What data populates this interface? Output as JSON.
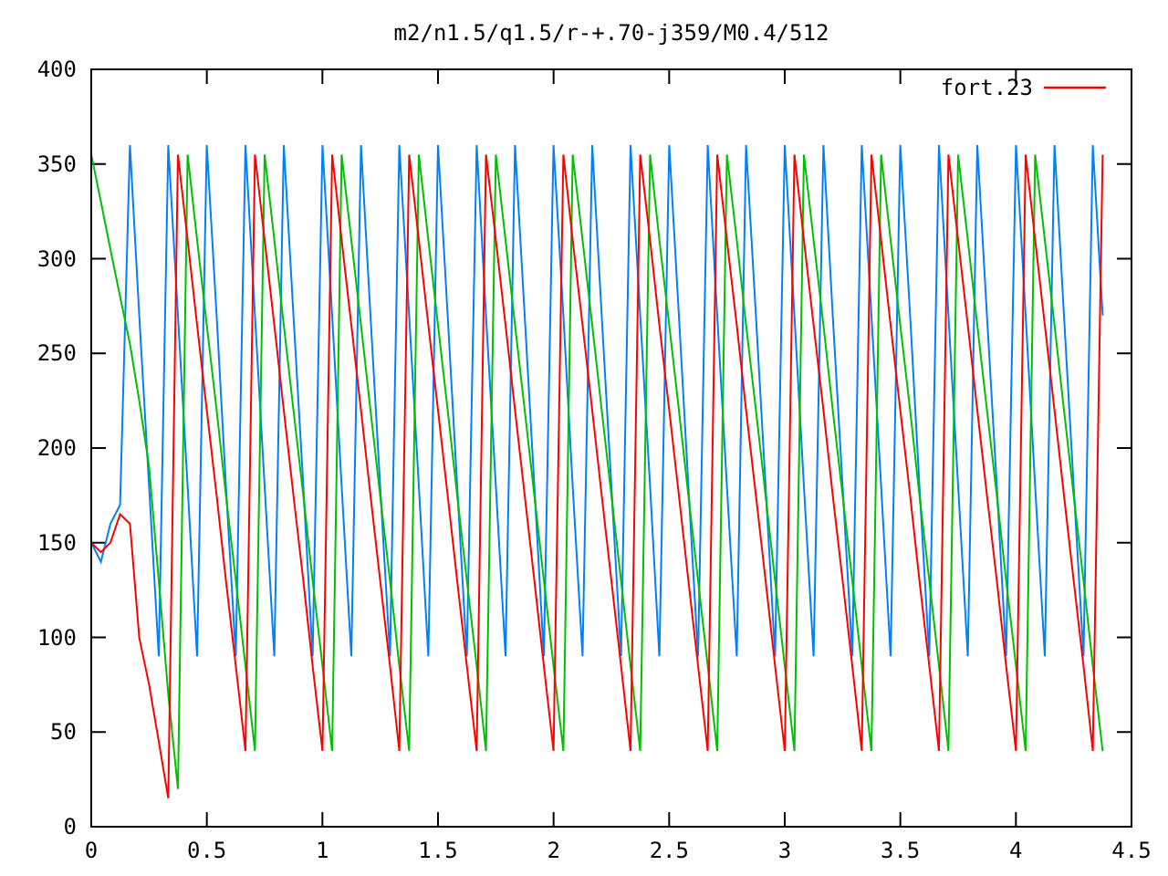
{
  "chart": {
    "chart_data": {
      "type": "line",
      "title": "m2/n1.5/q1.5/r-+.70-j359/M0.4/512",
      "xlim": [
        0,
        4.5
      ],
      "ylim": [
        0,
        400
      ],
      "xticks": [
        0,
        0.5,
        1,
        1.5,
        2,
        2.5,
        3,
        3.5,
        4,
        4.5
      ],
      "yticks": [
        0,
        50,
        100,
        150,
        200,
        250,
        300,
        350,
        400
      ],
      "x": [
        0,
        0.042,
        0.083,
        0.125,
        0.167,
        0.208,
        0.25,
        0.292,
        0.333,
        0.375,
        0.417,
        0.458,
        0.5,
        0.542,
        0.583,
        0.625,
        0.667,
        0.708,
        0.75,
        0.792,
        0.833,
        0.875,
        0.917,
        0.958,
        1,
        1.042,
        1.083,
        1.125,
        1.167,
        1.208,
        1.25,
        1.292,
        1.333,
        1.375,
        1.417,
        1.458,
        1.5,
        1.542,
        1.583,
        1.625,
        1.667,
        1.708,
        1.75,
        1.792,
        1.833,
        1.875,
        1.917,
        1.958,
        2,
        2.042,
        2.083,
        2.125,
        2.167,
        2.208,
        2.25,
        2.292,
        2.333,
        2.375,
        2.417,
        2.458,
        2.5,
        2.542,
        2.583,
        2.625,
        2.667,
        2.708,
        2.75,
        2.792,
        2.833,
        2.875,
        2.917,
        2.958,
        3,
        3.042,
        3.083,
        3.125,
        3.167,
        3.208,
        3.25,
        3.292,
        3.333,
        3.375,
        3.417,
        3.458,
        3.5,
        3.542,
        3.583,
        3.625,
        3.667,
        3.708,
        3.75,
        3.792,
        3.833,
        3.875,
        3.917,
        3.958,
        4,
        4.042,
        4.083,
        4.125,
        4.167,
        4.208,
        4.25,
        4.292,
        4.333,
        4.375
      ],
      "series": [
        {
          "color": "#0080ff",
          "values": [
            150,
            140,
            160,
            170,
            360,
            270,
            180,
            90,
            360,
            270,
            180,
            90,
            360,
            270,
            180,
            90,
            360,
            270,
            180,
            90,
            360,
            270,
            180,
            90,
            360,
            270,
            180,
            90,
            360,
            270,
            180,
            90,
            360,
            270,
            180,
            90,
            360,
            270,
            180,
            90,
            360,
            270,
            180,
            90,
            360,
            270,
            180,
            90,
            360,
            270,
            180,
            90,
            360,
            270,
            180,
            90,
            360,
            270,
            180,
            90,
            360,
            270,
            180,
            90,
            360,
            270,
            180,
            90,
            360,
            270,
            180,
            90,
            360,
            270,
            180,
            90,
            360,
            270,
            180,
            90,
            360,
            270,
            180,
            90,
            360,
            270,
            180,
            90,
            360,
            270,
            180,
            90,
            360,
            270,
            180,
            90,
            360,
            270,
            180,
            90,
            360,
            270,
            180,
            90,
            360,
            270
          ]
        },
        {
          "color": "#00c000",
          "values": [
            355,
            330,
            305,
            280,
            255,
            225,
            190,
            130,
            70,
            20,
            355,
            310,
            265,
            220,
            175,
            130,
            85,
            40,
            355,
            310,
            265,
            220,
            175,
            130,
            85,
            40,
            355,
            310,
            265,
            220,
            175,
            130,
            85,
            40,
            355,
            310,
            265,
            220,
            175,
            130,
            85,
            40,
            355,
            310,
            265,
            220,
            175,
            130,
            85,
            40,
            355,
            310,
            265,
            220,
            175,
            130,
            85,
            40,
            355,
            310,
            265,
            220,
            175,
            130,
            85,
            40,
            355,
            310,
            265,
            220,
            175,
            130,
            85,
            40,
            355,
            310,
            265,
            220,
            175,
            130,
            85,
            40,
            355,
            310,
            265,
            220,
            175,
            130,
            85,
            40,
            355,
            310,
            265,
            220,
            175,
            130,
            85,
            40,
            355,
            310,
            265,
            220,
            175,
            130,
            85,
            40
          ]
        },
        {
          "name": "fort.23",
          "color": "#ff0000",
          "values": [
            150,
            145,
            150,
            165,
            160,
            100,
            75,
            45,
            15,
            355,
            310,
            265,
            220,
            175,
            130,
            85,
            40,
            355,
            310,
            265,
            220,
            175,
            130,
            85,
            40,
            355,
            310,
            265,
            220,
            175,
            130,
            85,
            40,
            355,
            310,
            265,
            220,
            175,
            130,
            85,
            40,
            355,
            310,
            265,
            220,
            175,
            130,
            85,
            40,
            355,
            310,
            265,
            220,
            175,
            130,
            85,
            40,
            355,
            310,
            265,
            220,
            175,
            130,
            85,
            40,
            355,
            310,
            265,
            220,
            175,
            130,
            85,
            40,
            355,
            310,
            265,
            220,
            175,
            130,
            85,
            40,
            355,
            310,
            265,
            220,
            175,
            130,
            85,
            40,
            355,
            310,
            265,
            220,
            175,
            130,
            85,
            40,
            355,
            310,
            265,
            220,
            175,
            130,
            85,
            40,
            355
          ]
        }
      ]
    }
  }
}
